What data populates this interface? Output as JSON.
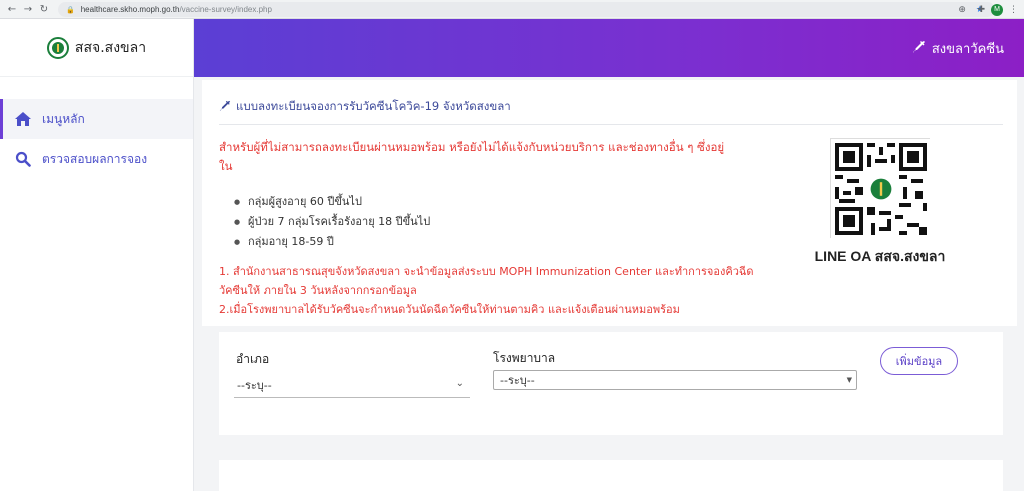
{
  "browser": {
    "url_host": "healthcare.skho.moph.go.th",
    "url_path": "/vaccine-survey/index.php",
    "avatar_letter": "M"
  },
  "sidebar": {
    "brand": "สสจ.สงขลา",
    "items": [
      {
        "label": "เมนูหลัก",
        "icon": "home-icon",
        "active": true
      },
      {
        "label": "ตรวจสอบผลการจอง",
        "icon": "search-icon",
        "active": false
      }
    ]
  },
  "header": {
    "title": "สงขลาวัคซีน",
    "icon": "syringe-icon"
  },
  "card": {
    "title": "แบบลงทะเบียนจองการรับวัคซีนโควิค-19 จังหวัดสงขลา",
    "intro": "สำหรับผู้ที่ไม่สามารถลงทะเบียนผ่านหมอพร้อม หรือยังไม่ได้แจ้งกับหน่วยบริการ และช่องทางอื่น ๆ ซึ่งอยู่ใน",
    "bullets": [
      "กลุ่มผู้สูงอายุ 60 ปีขึ้นไป",
      "ผู้ป่วย 7 กลุ่มโรคเรื้อรังอายุ 18 ปีขึ้นไป",
      "กลุ่มอายุ 18-59 ปี"
    ],
    "note1": "1. สำนักงานสาธารณสุขจังหวัดสงขลา จะนำข้อมูลส่งระบบ MOPH Immunization Center และทำการจองคิวฉีดวัคซีนให้ ภายใน 3 วันหลังจากกรอกข้อมูล",
    "note2": "2.เมื่อโรงพยาบาลได้รับวัคซีนจะกำหนดวันนัดฉีดวัคซีนให้ท่านตามคิว และแจ้งเตือนผ่านหมอพร้อม",
    "qr_label": "LINE OA สสจ.สงขลา"
  },
  "form": {
    "amphoe_label": "อำเภอ",
    "amphoe_value": "--ระบุ--",
    "hospital_label": "โรงพยาบาล",
    "hospital_value": "--ระบุ--",
    "add_button": "เพิ่มข้อมูล"
  },
  "colors": {
    "accent": "#5b3fd4",
    "accent_end": "#8c1fc6",
    "alert": "#e53935",
    "link": "#4b4fc9"
  }
}
